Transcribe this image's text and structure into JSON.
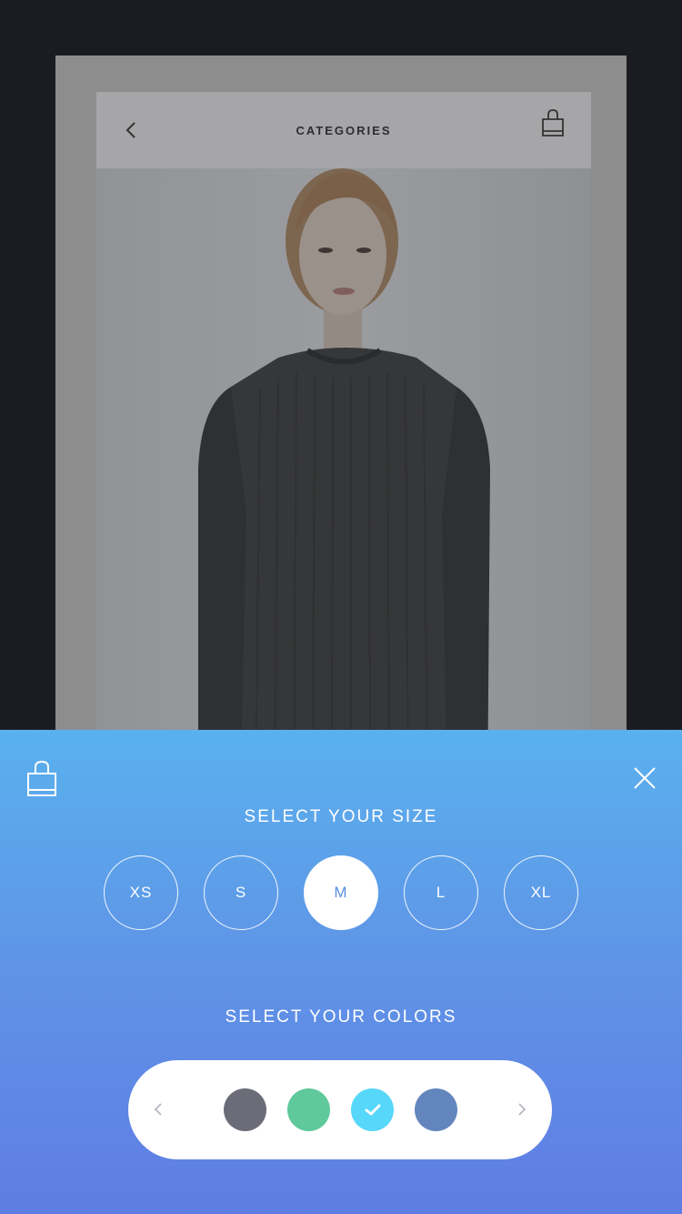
{
  "navbar": {
    "title": "CATEGORIES"
  },
  "size_section": {
    "title": "SELECT YOUR SIZE",
    "sizes": [
      "XS",
      "S",
      "M",
      "L",
      "XL"
    ],
    "selected": "M"
  },
  "color_section": {
    "title": "SELECT YOUR COLORS",
    "swatches": [
      {
        "name": "charcoal",
        "color": "#6b6c78",
        "selected": false
      },
      {
        "name": "green",
        "color": "#5fc99c",
        "selected": false
      },
      {
        "name": "cyan",
        "color": "#57d7fa",
        "selected": true
      },
      {
        "name": "blue",
        "color": "#6385bd",
        "selected": false
      }
    ]
  },
  "icons": {
    "back": "chevron-left-icon",
    "nav_bag": "shopping-bag-icon",
    "sheet_bag": "shopping-bag-icon",
    "close": "close-icon",
    "prev": "chevron-left-icon",
    "next": "chevron-right-icon",
    "check": "checkmark-icon"
  },
  "colors": {
    "sheet_gradient_top": "#5ab1ee",
    "sheet_gradient_bottom": "#5f7de4",
    "selected_size_text": "#5b8fe5"
  }
}
